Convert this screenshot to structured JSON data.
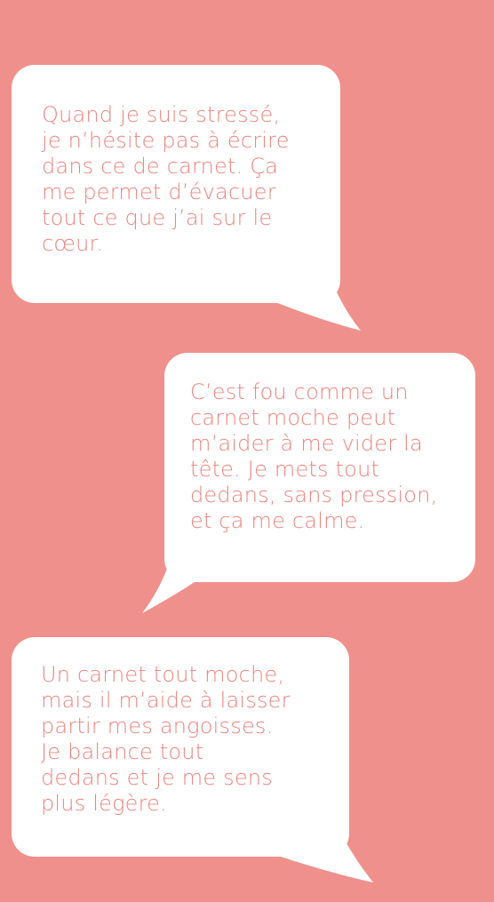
{
  "colors": {
    "background": "#f0908c",
    "bubble": "#ffffff",
    "text": "#ec857f"
  },
  "bubbles": [
    {
      "text": "Quand je suis stressé,\nje n’hésite pas à écrire\ndans ce  de carnet. Ça\nme permet d’évacuer\ntout ce que j’ai sur le\ncœur."
    },
    {
      "text": "C’est fou comme un\ncarnet moche peut\nm’aider à me vider la\ntête. Je mets tout\ndedans, sans pression,\net ça me calme."
    },
    {
      "text": "Un carnet tout moche,\nmais il m’aide à laisser\npartir mes angoisses.\nJe balance tout\ndedans et je me sens\nplus légère."
    }
  ]
}
